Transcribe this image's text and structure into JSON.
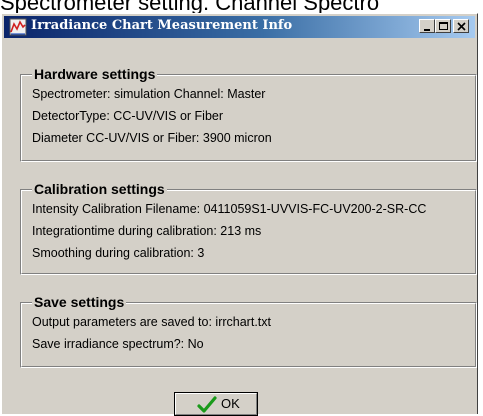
{
  "background": {
    "top_text": "Spectrometer setting. Channel Spectro",
    "left_fragment_a": "T",
    "left_fragment_b": "I"
  },
  "window": {
    "title": "Irradiance Chart Measurement Info",
    "icon": "app-chart-icon",
    "buttons": [
      "minimize-icon",
      "maximize-icon",
      "close-icon"
    ]
  },
  "hardware": {
    "legend": "Hardware settings",
    "lines": [
      "Spectrometer: simulation  Channel: Master",
      "DetectorType: CC-UV/VIS or Fiber",
      "Diameter CC-UV/VIS or Fiber: 3900 micron"
    ]
  },
  "calibration": {
    "legend": "Calibration settings",
    "lines": [
      "Intensity Calibration Filename: 0411059S1-UVVIS-FC-UV200-2-SR-CC",
      "Integrationtime during calibration: 213 ms",
      "Smoothing during calibration: 3"
    ]
  },
  "save": {
    "legend": "Save settings",
    "lines": [
      "Output parameters are saved to: irrchart.txt",
      "Save irradiance spectrum?: No"
    ]
  },
  "ok_button": {
    "label": "OK",
    "icon": "checkmark-icon",
    "icon_color": "#1a9a1a"
  },
  "colors": {
    "title_gradient_start": "#0a246a",
    "title_gradient_end": "#a6caf0",
    "dialog_face": "#d4d0c8"
  }
}
